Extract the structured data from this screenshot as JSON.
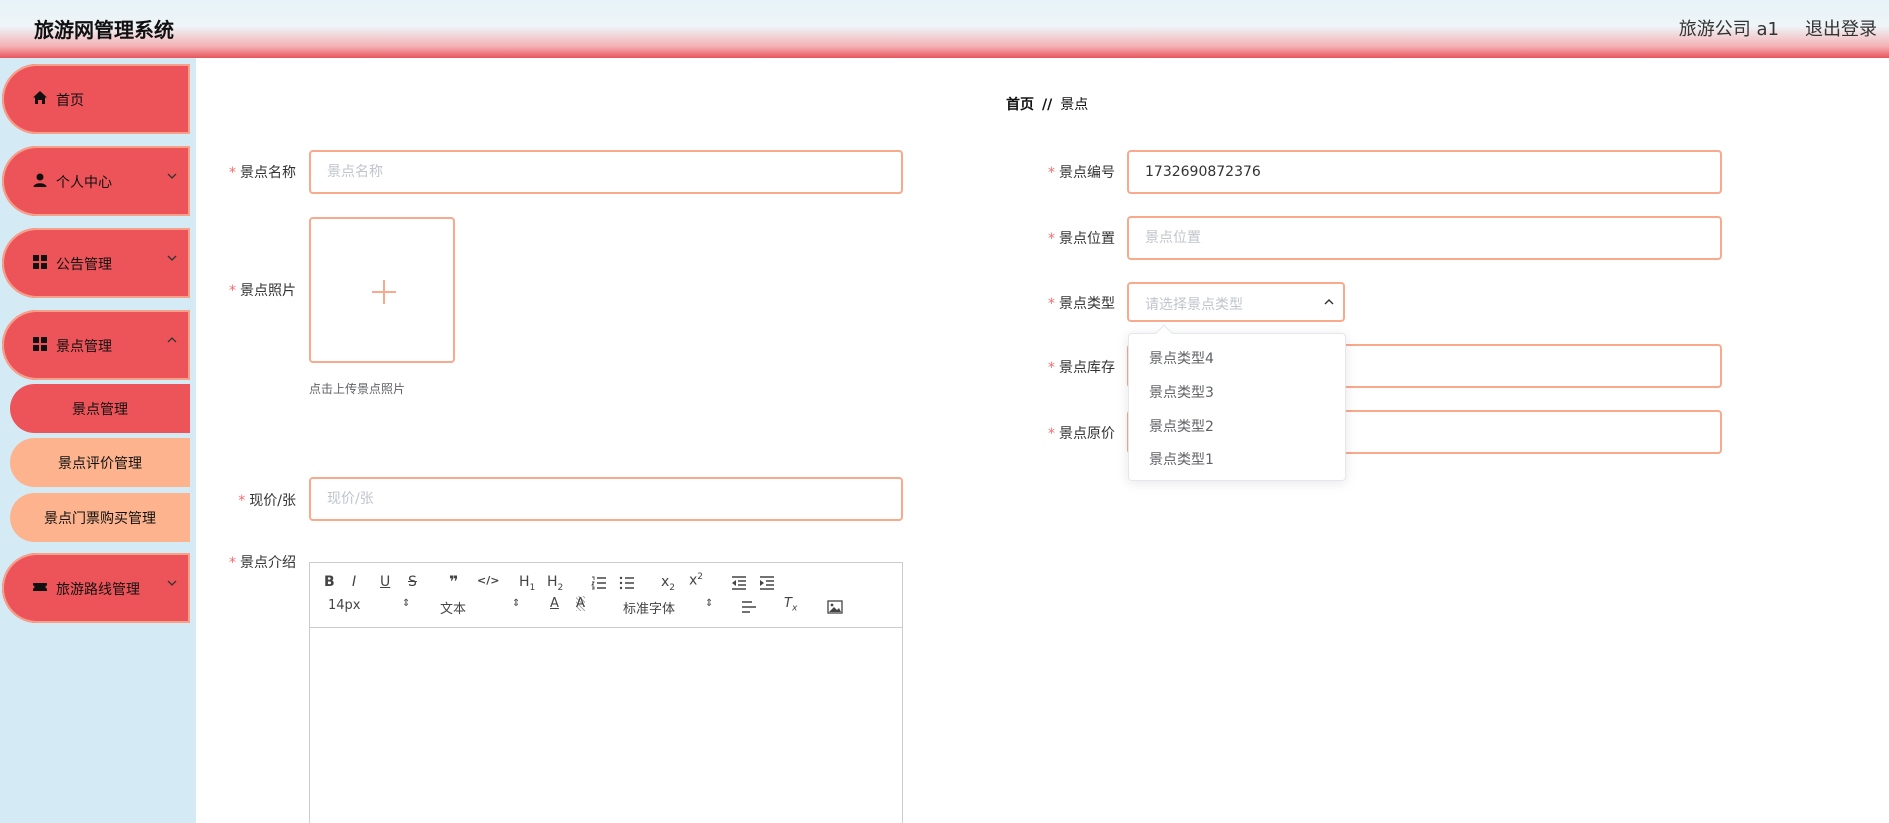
{
  "header": {
    "title": "旅游网管理系统",
    "user": "旅游公司 a1",
    "logout": "退出登录"
  },
  "sidebar": {
    "items": [
      {
        "label": "首页",
        "icon": "home-icon"
      },
      {
        "label": "个人中心",
        "icon": "user-icon"
      },
      {
        "label": "公告管理",
        "icon": "grid-icon"
      },
      {
        "label": "景点管理",
        "icon": "grid-icon"
      },
      {
        "label": "旅游路线管理",
        "icon": "ticket-icon"
      }
    ],
    "sub_items": [
      {
        "label": "景点管理",
        "active": true
      },
      {
        "label": "景点评价管理",
        "active": false
      },
      {
        "label": "景点门票购买管理",
        "active": false
      }
    ]
  },
  "breadcrumb": {
    "home": "首页",
    "separator": "//",
    "current": "景点"
  },
  "form": {
    "required_mark": "*",
    "name": {
      "label": "景点名称",
      "placeholder": "景点名称",
      "value": ""
    },
    "code": {
      "label": "景点编号",
      "placeholder": "景点编号",
      "value": "1732690872376"
    },
    "photo": {
      "label": "景点照片",
      "hint": "点击上传景点照片"
    },
    "location": {
      "label": "景点位置",
      "placeholder": "景点位置",
      "value": ""
    },
    "type": {
      "label": "景点类型",
      "placeholder": "请选择景点类型",
      "options": [
        "景点类型4",
        "景点类型3",
        "景点类型2",
        "景点类型1"
      ]
    },
    "stock": {
      "label": "景点库存",
      "placeholder": "",
      "value": ""
    },
    "original_price": {
      "label": "景点原价",
      "placeholder": "",
      "value": ""
    },
    "current_price": {
      "label": "现价/张",
      "placeholder": "现价/张",
      "value": ""
    },
    "intro": {
      "label": "景点介绍"
    }
  },
  "editor": {
    "font_size": "14px",
    "text_style": "文本",
    "font_family": "标准字体"
  },
  "colors": {
    "accent_red": "#ec5459",
    "accent_orange": "#fdb48e",
    "border": "#f9a98c",
    "sidebar_bg": "#d4ebf5"
  }
}
